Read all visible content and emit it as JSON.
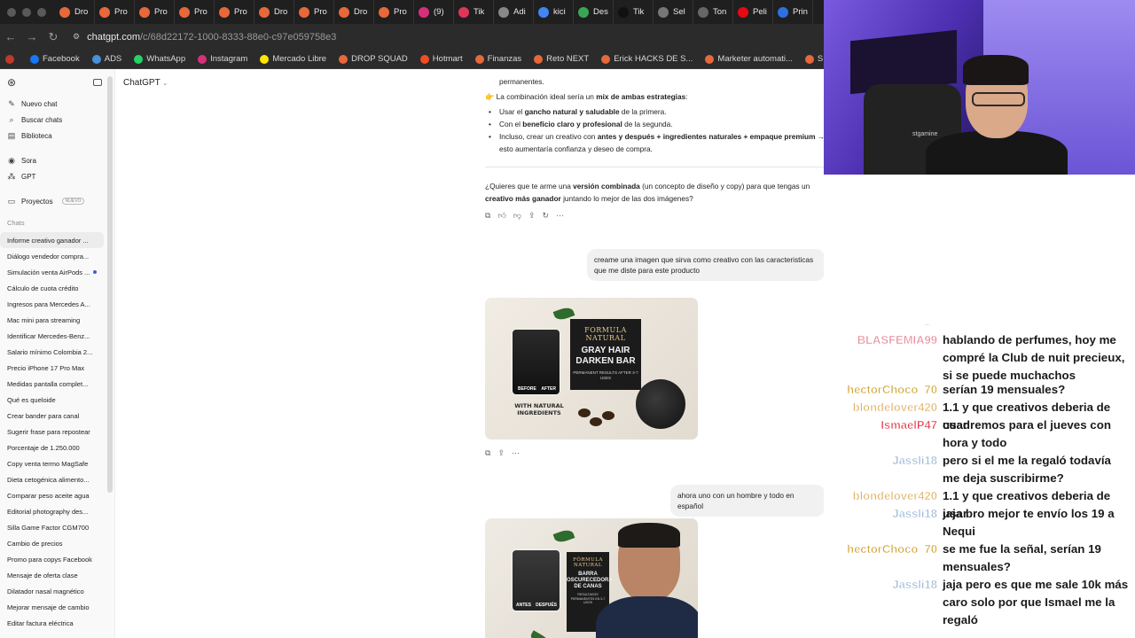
{
  "browser": {
    "tabs": [
      {
        "label": "Dro",
        "icon": "orange-circle-icon",
        "color": "#e8683a"
      },
      {
        "label": "Pro",
        "icon": "orange-circle-icon",
        "color": "#e8683a"
      },
      {
        "label": "Pro",
        "icon": "orange-circle-icon",
        "color": "#e8683a"
      },
      {
        "label": "Pro",
        "icon": "orange-circle-icon",
        "color": "#e8683a"
      },
      {
        "label": "Pro",
        "icon": "orange-circle-icon",
        "color": "#e8683a"
      },
      {
        "label": "Dro",
        "icon": "orange-circle-icon",
        "color": "#e8683a"
      },
      {
        "label": "Pro",
        "icon": "orange-circle-icon",
        "color": "#e8683a"
      },
      {
        "label": "Dro",
        "icon": "orange-circle-icon",
        "color": "#e8683a"
      },
      {
        "label": "Pro",
        "icon": "orange-circle-icon",
        "color": "#e8683a"
      },
      {
        "label": "(9)",
        "icon": "instagram-icon",
        "color": "#d6307a"
      },
      {
        "label": "Tik",
        "icon": "tiktok-icon",
        "color": "#e0365a"
      },
      {
        "label": "Adi",
        "icon": "generic-icon",
        "color": "#888888"
      },
      {
        "label": "kici",
        "icon": "google-icon",
        "color": "#4285f4"
      },
      {
        "label": "Des",
        "icon": "download-icon",
        "color": "#3aa655"
      },
      {
        "label": "Tik",
        "icon": "tiktok-icon",
        "color": "#111111"
      },
      {
        "label": "Sel",
        "icon": "generic-icon",
        "color": "#777777"
      },
      {
        "label": "Ton",
        "icon": "generic-icon",
        "color": "#666666"
      },
      {
        "label": "Peli",
        "icon": "netflix-icon",
        "color": "#e50914"
      },
      {
        "label": "Prin",
        "icon": "generic-icon",
        "color": "#2f6fe0"
      }
    ],
    "url_host": "chatgpt.com",
    "url_path": "/c/68d22172-1000-8333-88e0-c97e059758e3",
    "bookmarks": [
      {
        "label": "",
        "color": "#c0392b"
      },
      {
        "label": "Facebook",
        "color": "#1877f2"
      },
      {
        "label": "ADS",
        "color": "#4a90d9"
      },
      {
        "label": "WhatsApp",
        "color": "#25d366"
      },
      {
        "label": "Instagram",
        "color": "#d6307a"
      },
      {
        "label": "Mercado Libre",
        "color": "#ffe600"
      },
      {
        "label": "DROP SQUAD",
        "color": "#e8683a"
      },
      {
        "label": "Hotmart",
        "color": "#f04e23"
      },
      {
        "label": "Finanzas",
        "color": "#e8683a"
      },
      {
        "label": "Reto NEXT",
        "color": "#e8683a"
      },
      {
        "label": "Erick HACKS DE S...",
        "color": "#e8683a"
      },
      {
        "label": "Marketer automati...",
        "color": "#e8683a"
      },
      {
        "label": "SEMINARIOS ONLI...",
        "color": "#e8683a"
      }
    ]
  },
  "sidebar": {
    "nav": [
      {
        "label": "Nuevo chat",
        "icon": "edit-icon"
      },
      {
        "label": "Buscar chats",
        "icon": "search-icon"
      },
      {
        "label": "Biblioteca",
        "icon": "library-icon"
      }
    ],
    "nav2": [
      {
        "label": "Sora",
        "icon": "sora-icon"
      },
      {
        "label": "GPT",
        "icon": "gpt-icon"
      }
    ],
    "projects_label": "Proyectos",
    "projects_badge": "NUEVO",
    "chats_heading": "Chats",
    "chats": [
      "Informe creativo ganador ...",
      "Diálogo vendedor compra...",
      "Simulación venta AirPods ...",
      "Cálculo de cuota crédito",
      "Ingresos para Mercedes A...",
      "Mac mini para streaming",
      "Identificar Mercedes-Benz...",
      "Salario mínimo Colombia 2...",
      "Precio iPhone 17 Pro Max",
      "Medidas pantalla complet...",
      "Qué es queloide",
      "Crear bander para canal",
      "Sugerir frase para repostear",
      "Porcentaje de 1.250.000",
      "Copy venta termo MagSafe",
      "Dieta cetogénica alimento...",
      "Comparar peso aceite agua",
      "Editorial photography des...",
      "Silla Game Factor CGM700",
      "Cambio de precios",
      "Promo para copys Facebook",
      "Mensaje de oferta clase",
      "Dilatador nasal magnético",
      "Mejorar mensaje de cambio",
      "Editar factura eléctrica"
    ]
  },
  "main": {
    "model": "ChatGPT",
    "cut_line": "permanentes.",
    "combo_emoji": "👉",
    "combo_a": "La combinación ideal sería un ",
    "combo_b": "mix de ambas estrategias",
    "combo_c": ":",
    "b1_a": "Usar el ",
    "b1_b": "gancho natural y saludable",
    "b1_c": " de la primera.",
    "b2_a": "Con el ",
    "b2_b": "beneficio claro y profesional",
    "b2_c": " de la segunda.",
    "b3_a": "Incluso, crear un creativo con ",
    "b3_b": "antes y después + ingredientes naturales + empaque premium →",
    "b3_c": "esto aumentaría confianza y deseo de compra.",
    "q_a": "¿Quieres que te arme una ",
    "q_b": "versión combinada",
    "q_c": " (un concepto de diseño y copy) para que tengas un",
    "q_d": "creativo más ganador",
    "q_e": " juntando lo mejor de las dos imágenes?",
    "user_msg_1": "creame una imagen que sirva como creativo con las caracteristicas que me diste para este producto",
    "user_msg_2": "ahora uno con un hombre y todo en español",
    "img1": {
      "box_top": "FORMULA NATURAL",
      "box_main": "GRAY HAIR DARKEN BAR",
      "box_small": "PERMANENT RESULTS AFTER 3-7 USES",
      "before": "BEFORE",
      "after": "AFTER",
      "natural": "WITH NATURAL INGREDIENTS"
    },
    "img2": {
      "box_top": "FÓRMULA NATURAL",
      "box_main": "BARRA OSCURECEDORA DE CANAS",
      "box_small": "RESULTADOS PERMANENTES EN 3-7 USOS",
      "before": "ANTES",
      "after": "DESPUÉS"
    }
  },
  "webcam": {
    "chair_brand": "stgamine"
  },
  "chat_overlay": {
    "tiny_text": "...",
    "messages": [
      {
        "user": "BLASFEMIA99",
        "color": "#e88a9a",
        "text": "hablando de perfumes, hoy me compré la Club de nuit precieux, si se puede muchachos"
      },
      {
        "user": "hectorChoco_70",
        "color": "#d2a63a",
        "text": "serían 19 mensuales?"
      },
      {
        "user": "blondelover420",
        "color": "#e0b46a",
        "text": "1.1 y que creativos deberia de usar"
      },
      {
        "user": "IsmaelP47",
        "color": "#e0394c",
        "text": "cuadremos para el jueves con hora y todo"
      },
      {
        "user": "Jassli18",
        "color": "#9db8d6",
        "text": "pero si el me la regaló todavía me deja suscribirme?"
      },
      {
        "user": "blondelover420",
        "color": "#e0b46a",
        "text": "1.1 y que creativos deberia de usar"
      },
      {
        "user": "Jassli18",
        "color": "#9db8d6",
        "text": "jaja bro mejor te envío los 19 a Nequi"
      },
      {
        "user": "hectorChoco_70",
        "color": "#d2a63a",
        "text": "se me fue la señal, serían 19 mensuales?"
      },
      {
        "user": "Jassli18",
        "color": "#9db8d6",
        "text": "jaja pero es que me sale 10k más caro solo por que Ismael me la regaló"
      }
    ]
  }
}
